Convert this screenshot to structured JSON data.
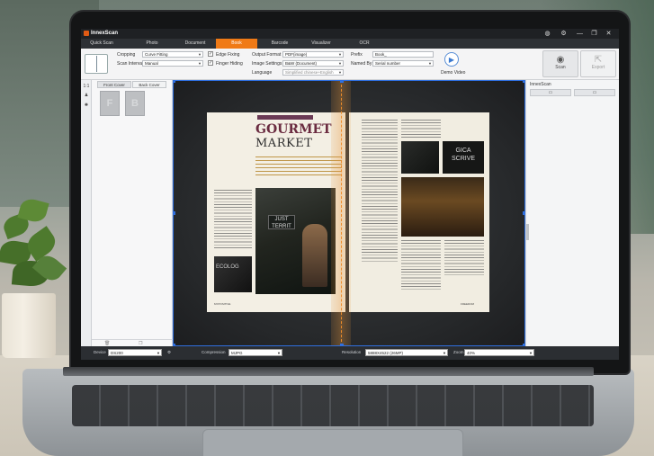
{
  "app": {
    "title": "InnexScan"
  },
  "window_icons": [
    "globe-icon",
    "settings-icon",
    "minimize-icon",
    "restore-icon",
    "close-icon"
  ],
  "tabs": [
    {
      "label": "Quick Scan"
    },
    {
      "label": "Photo"
    },
    {
      "label": "Document"
    },
    {
      "label": "Book",
      "active": true
    },
    {
      "label": "Barcode"
    },
    {
      "label": "Visualizer"
    },
    {
      "label": "OCR"
    }
  ],
  "toolbar": {
    "cropping_label": "Cropping",
    "cropping_value": "Curve Fitting",
    "scan_interval_label": "Scan Interval",
    "scan_interval_value": "Manual",
    "edge_fixing_label": "Edge Fixing",
    "edge_fixing_checked": true,
    "finger_hiding_label": "Finger Hiding",
    "finger_hiding_checked": true,
    "output_format_label": "Output Format",
    "output_format_value": "PDF(image)",
    "image_settings_label": "Image Settings",
    "image_settings_value": "B&W (Document)",
    "language_label": "Language",
    "language_value": "Simplified chinese+English",
    "prefix_label": "Prefix",
    "prefix_value": "Book_",
    "named_by_label": "Named By",
    "named_by_value": "Serial number",
    "demo_label": "Demo Video",
    "scan_label": "Scan",
    "export_label": "Export"
  },
  "left_panel": {
    "ratio_label": "1:1",
    "front_cover_label": "Front Cover",
    "back_cover_label": "Back Cover",
    "front_tile_letter": "F",
    "back_tile_letter": "B"
  },
  "magazine": {
    "title_line1": "GOURMET",
    "title_line2": "MARKET",
    "left_footer": "MYPOSITIVE",
    "right_footer": "FREEDOM"
  },
  "right_panel": {
    "title": "InnexScan"
  },
  "status": {
    "device_label": "Device",
    "device_value": "DS200",
    "compression_label": "Compression",
    "compression_value": "MJPG",
    "resolution_label": "Resolution",
    "resolution_value": "5888X4522 (26MP)",
    "zoom_label": "Zoom",
    "zoom_value": "40%"
  },
  "colors": {
    "accent": "#f07a16",
    "selection": "#2f6fe0",
    "seam": "#ee8c2a",
    "title_dark": "#1f2124"
  }
}
